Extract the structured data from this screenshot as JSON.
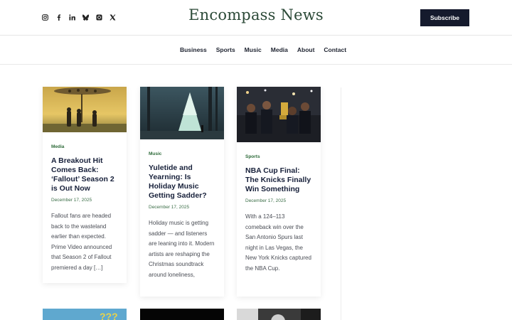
{
  "header": {
    "brand": "Encompass News",
    "subscribe_label": "Subscribe",
    "socials": [
      "instagram-icon",
      "facebook-icon",
      "linkedin-icon",
      "bluesky-icon",
      "threads-icon",
      "x-icon"
    ]
  },
  "nav": {
    "items": [
      "Business",
      "Sports",
      "Music",
      "Media",
      "About",
      "Contact"
    ]
  },
  "articles": [
    {
      "category": "Media",
      "title": "A Breakout Hit Comes Back: ‘Fallout’ Season 2 is Out Now",
      "date": "December 17, 2025",
      "excerpt": "Fallout fans are headed back to the wasteland earlier than expected. Prime Video announced that Season 2 of Fallout premiered a day […]"
    },
    {
      "category": "Music",
      "title": "Yuletide and Yearning: Is Holiday Music Getting Sadder?",
      "date": "December 17, 2025",
      "excerpt": "Holiday music is getting sadder — and listeners are leaning into it. Modern artists are reshaping the Christmas soundtrack around loneliness,"
    },
    {
      "category": "Sports",
      "title": "NBA Cup Final: The Knicks Finally Win Something",
      "date": "December 17, 2025",
      "excerpt": "With a 124–113 comeback win over the San Antonio Spurs last night in Las Vegas, the New York Knicks captured the NBA Cup."
    }
  ],
  "colors": {
    "brand_green": "#2c4a38",
    "button_navy": "#151a2d",
    "category_green": "#2e6b3a"
  }
}
